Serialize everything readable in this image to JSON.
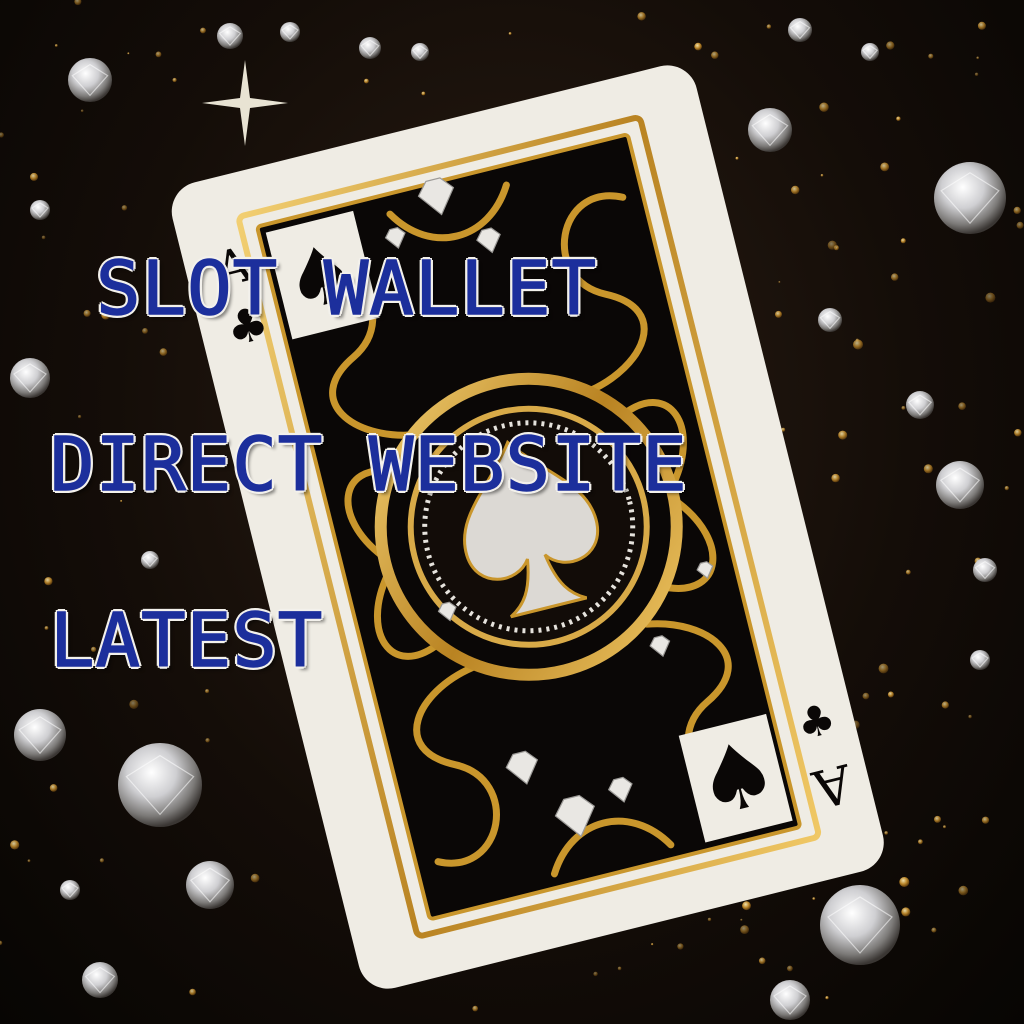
{
  "headline": {
    "line1": "SLOT WALLET",
    "line2": "DIRECT WEBSITE",
    "line3": "LATEST"
  },
  "card": {
    "suit": "spade",
    "rank": "A",
    "color_face": "#efece4",
    "color_gold": "#c9962c",
    "color_ink": "#0a0706"
  },
  "colors": {
    "background": "#140d08",
    "text_fill": "#1c2f9c",
    "text_outline": "#f3f1ec",
    "gem": "#e8e6e2",
    "sparkle_gold": "#d4a24a"
  }
}
